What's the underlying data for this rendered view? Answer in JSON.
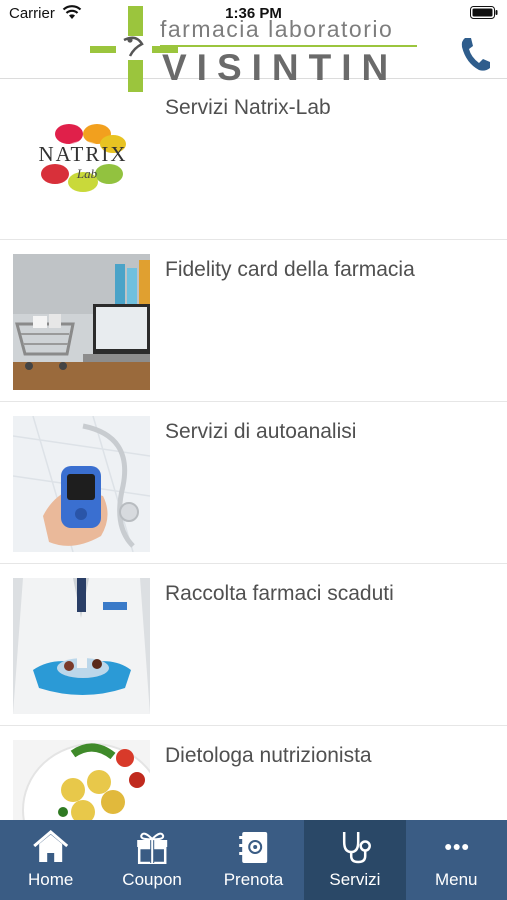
{
  "status_bar": {
    "carrier": "Carrier",
    "time": "1:36 PM"
  },
  "header": {
    "logo_top": "farmacia laboratorio",
    "logo_bottom": "VISINTIN"
  },
  "services": [
    {
      "title": "Servizi Natrix-Lab",
      "logo_text": "NATRIX",
      "logo_sub": "Lab"
    },
    {
      "title": "Fidelity card della farmacia"
    },
    {
      "title": "Servizi di autoanalisi"
    },
    {
      "title": "Raccolta farmaci scaduti"
    },
    {
      "title": "Dietologa nutrizionista"
    }
  ],
  "tabs": [
    {
      "label": "Home",
      "icon": "home-icon"
    },
    {
      "label": "Coupon",
      "icon": "gift-icon"
    },
    {
      "label": "Prenota",
      "icon": "booking-icon"
    },
    {
      "label": "Servizi",
      "icon": "stethoscope-icon",
      "active": true
    },
    {
      "label": "Menu",
      "icon": "more-icon"
    }
  ],
  "colors": {
    "tabbar": "#3a5c84",
    "tab_active": "#2a4867",
    "logo_green": "#9bc53d",
    "phone": "#2f5d8c"
  }
}
